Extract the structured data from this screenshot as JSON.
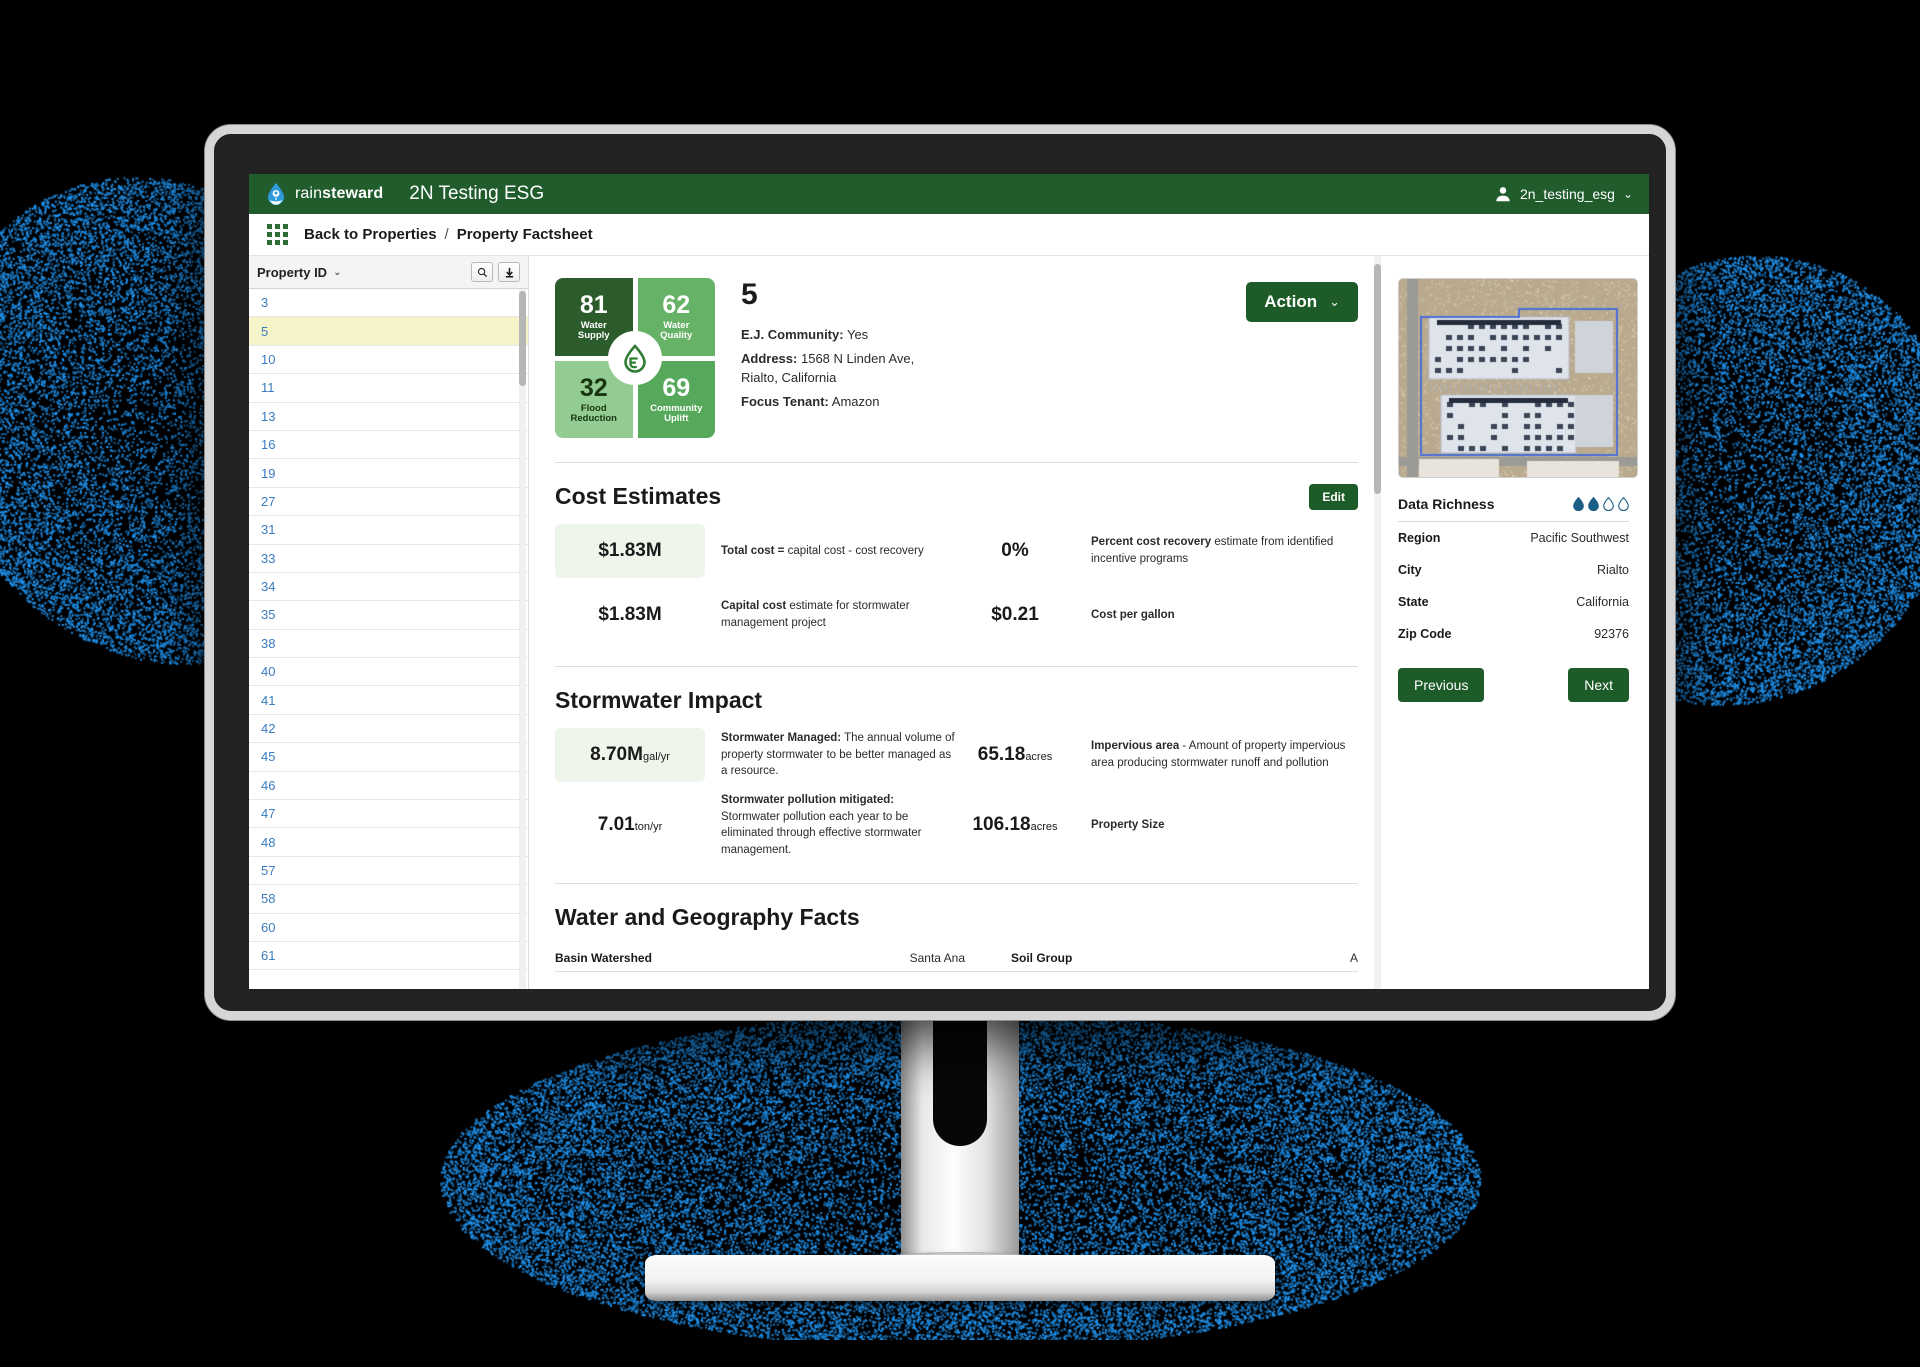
{
  "topbar": {
    "brand_prefix": "rain",
    "brand_suffix": "steward",
    "app_title": "2N Testing ESG",
    "user": "2n_testing_esg",
    "caret": "⌄",
    "logo_icon": "water-drop-pin-logo",
    "avatar_icon": "user-avatar-icon"
  },
  "breadcrumb": {
    "waffle_icon": "app-grid-icon",
    "back_label": "Back to Properties",
    "separator": "/",
    "current_label": "Property Factsheet"
  },
  "left_panel": {
    "column_header": "Property ID",
    "sort_caret": "⌄",
    "search_icon": "search-icon",
    "download_icon": "download-arrow-icon",
    "selected_id": "5",
    "ids": [
      "3",
      "5",
      "10",
      "11",
      "13",
      "16",
      "19",
      "27",
      "31",
      "33",
      "34",
      "35",
      "38",
      "40",
      "41",
      "42",
      "45",
      "46",
      "47",
      "48",
      "57",
      "58",
      "60",
      "61"
    ]
  },
  "hero": {
    "scores": [
      {
        "value": "81",
        "label_line1": "Water",
        "label_line2": "Supply",
        "color": "#2c5c2c"
      },
      {
        "value": "62",
        "label_line1": "Water",
        "label_line2": "Quality",
        "color": "#66b266"
      },
      {
        "value": "32",
        "label_line1": "Flood",
        "label_line2": "Reduction",
        "color": "#93cc93"
      },
      {
        "value": "69",
        "label_line1": "Community",
        "label_line2": "Uplift",
        "color": "#56a85b"
      }
    ],
    "center_badge_icon": "rainsteward-leaf-drop-icon",
    "property_id": "5",
    "ej_community_label": "E.J. Community:",
    "ej_community_value": "Yes",
    "address_label": "Address:",
    "address_line1": "1568 N Linden Ave,",
    "address_line2": "Rialto, California",
    "focus_tenant_label": "Focus Tenant:",
    "focus_tenant_value": "Amazon",
    "action_label": "Action",
    "action_caret": "⌄"
  },
  "cost_estimates": {
    "title": "Cost Estimates",
    "edit_label": "Edit",
    "rows": [
      {
        "value": "$1.83M",
        "unit": "",
        "desc_bold": "Total cost =",
        "desc_rest": "capital cost - cost recovery",
        "value2": "0%",
        "unit2": "",
        "desc2_bold": "Percent cost recovery",
        "desc2_rest": " estimate from identified incentive programs",
        "highlight": true
      },
      {
        "value": "$1.83M",
        "unit": "",
        "desc_bold": "Capital cost",
        "desc_rest": " estimate for stormwater management project",
        "value2": "$0.21",
        "unit2": "",
        "desc2_bold": "Cost per gallon",
        "desc2_rest": "",
        "highlight": false
      }
    ]
  },
  "stormwater_impact": {
    "title": "Stormwater Impact",
    "rows": [
      {
        "value": "8.70M",
        "unit": "gal/yr",
        "desc_bold": "Stormwater Managed:",
        "desc_rest": " The annual volume of property stormwater to be better managed as a resource.",
        "value2": "65.18",
        "unit2": "acres",
        "desc2_bold": "Impervious area",
        "desc2_rest": " - Amount of property impervious area producing stormwater runoff and pollution",
        "highlight": true
      },
      {
        "value": "7.01",
        "unit": "ton/yr",
        "desc_bold": "Stormwater pollution mitigated:",
        "desc_rest": " Stormwater pollution each year to be eliminated through effective stormwater management.",
        "value2": "106.18",
        "unit2": "acres",
        "desc2_bold": "Property Size",
        "desc2_rest": "",
        "highlight": false
      }
    ]
  },
  "water_geography": {
    "title": "Water and Geography Facts",
    "rows": [
      {
        "key1": "Basin Watershed",
        "val1": "Santa Ana",
        "key2": "Soil Group",
        "val2": "A"
      }
    ]
  },
  "right_panel": {
    "aerial_icon": "aerial-satellite-property-image",
    "data_richness_label": "Data Richness",
    "drops_filled": 2,
    "drops_total": 4,
    "drop_color": "#1b5f87",
    "details": [
      {
        "key": "Region",
        "value": "Pacific Southwest"
      },
      {
        "key": "City",
        "value": "Rialto"
      },
      {
        "key": "State",
        "value": "California"
      },
      {
        "key": "Zip Code",
        "value": "92376"
      }
    ],
    "previous_label": "Previous",
    "next_label": "Next"
  },
  "theme": {
    "brand_green": "#205c2c",
    "button_green": "#1d5c28",
    "link_blue": "#3a7bbf",
    "selected_row": "#f5f3c8",
    "particle_blue": "#2196f3"
  }
}
